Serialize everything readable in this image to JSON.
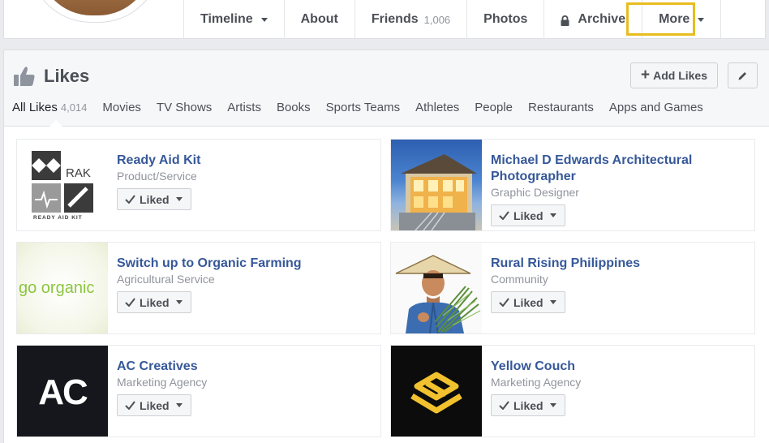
{
  "nav": {
    "tabs": [
      {
        "label": "Timeline",
        "count": "",
        "dropdown": true
      },
      {
        "label": "About",
        "count": ""
      },
      {
        "label": "Friends",
        "count": "1,006"
      },
      {
        "label": "Photos",
        "count": ""
      },
      {
        "label": "Archive",
        "count": "",
        "icon": "lock-icon"
      },
      {
        "label": "More",
        "count": "",
        "dropdown": true,
        "highlighted": true
      }
    ]
  },
  "likes": {
    "title": "Likes",
    "add_button": "Add Likes",
    "subtabs": [
      {
        "label": "All Likes",
        "count": "4,014",
        "active": true
      },
      {
        "label": "Movies"
      },
      {
        "label": "TV Shows"
      },
      {
        "label": "Artists"
      },
      {
        "label": "Books"
      },
      {
        "label": "Sports Teams"
      },
      {
        "label": "Athletes"
      },
      {
        "label": "People"
      },
      {
        "label": "Restaurants"
      },
      {
        "label": "Apps and Games"
      }
    ],
    "items": [
      {
        "name": "Ready Aid Kit",
        "category": "Product/Service",
        "button": "Liked",
        "logo_text": "RAK",
        "logo_sub": "READY AID KIT"
      },
      {
        "name": "Michael D Edwards Architectural Photographer",
        "category": "Graphic Designer",
        "button": "Liked"
      },
      {
        "name": "Switch up to Organic Farming",
        "category": "Agricultural Service",
        "button": "Liked",
        "logo_text": "go organic"
      },
      {
        "name": "Rural Rising Philippines",
        "category": "Community",
        "button": "Liked"
      },
      {
        "name": "AC Creatives",
        "category": "Marketing Agency",
        "button": "Liked",
        "logo_text": "AC"
      },
      {
        "name": "Yellow Couch",
        "category": "Marketing Agency",
        "button": "Liked"
      }
    ]
  },
  "colors": {
    "link_blue": "#365899",
    "highlight": "#e7bd1f",
    "muted": "#90949c",
    "text": "#4b4f56",
    "organic_green": "#8cc63f",
    "yellow_couch": "#f2c12e"
  }
}
